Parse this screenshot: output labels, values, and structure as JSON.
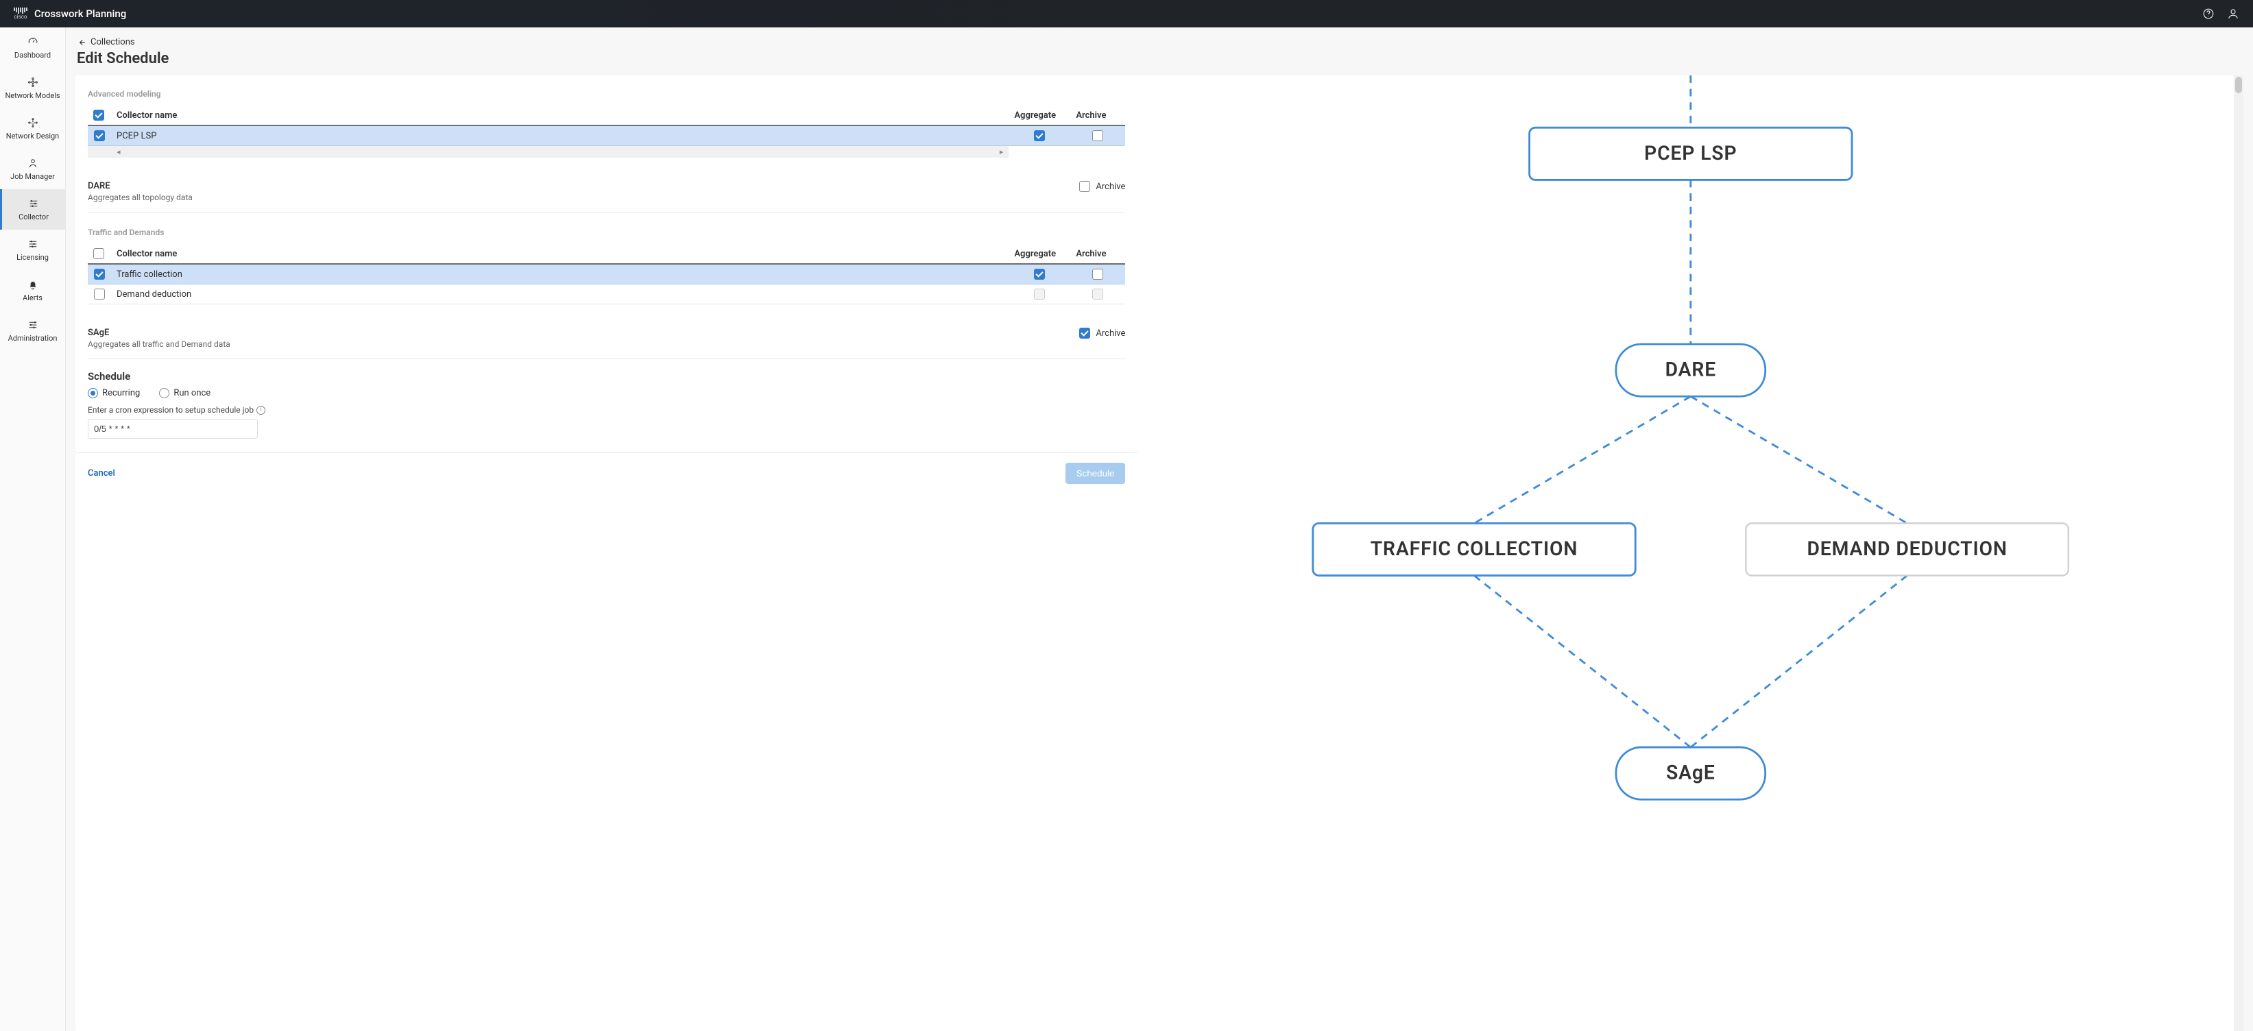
{
  "header": {
    "brand_sub": "cisco",
    "title": "Crosswork Planning"
  },
  "nav": {
    "items": [
      {
        "id": "dashboard",
        "label": "Dashboard"
      },
      {
        "id": "network-models",
        "label": "Network Models"
      },
      {
        "id": "network-design",
        "label": "Network Design"
      },
      {
        "id": "job-manager",
        "label": "Job Manager"
      },
      {
        "id": "collector",
        "label": "Collector"
      },
      {
        "id": "licensing",
        "label": "Licensing"
      },
      {
        "id": "alerts",
        "label": "Alerts"
      },
      {
        "id": "administration",
        "label": "Administration"
      }
    ],
    "active": "collector"
  },
  "breadcrumb": {
    "label": "Collections"
  },
  "page": {
    "title": "Edit Schedule"
  },
  "sections": {
    "advanced": {
      "title": "Advanced modeling",
      "cols": {
        "name": "Collector name",
        "aggregate": "Aggregate",
        "archive": "Archive"
      },
      "head_checked": true,
      "rows": [
        {
          "name": "PCEP LSP",
          "checked": true,
          "aggregate": true,
          "archive": false,
          "highlight": true
        }
      ]
    },
    "dare": {
      "title": "DARE",
      "desc": "Aggregates all topology data",
      "archive_label": "Archive",
      "archive_checked": false
    },
    "traffic": {
      "title": "Traffic and Demands",
      "cols": {
        "name": "Collector name",
        "aggregate": "Aggregate",
        "archive": "Archive"
      },
      "head_checked": false,
      "rows": [
        {
          "name": "Traffic collection",
          "checked": true,
          "aggregate": true,
          "archive": false,
          "highlight": true
        },
        {
          "name": "Demand deduction",
          "checked": false,
          "aggregate_disabled": true,
          "archive_disabled": true,
          "highlight": false
        }
      ]
    },
    "sage": {
      "title": "SAgE",
      "desc": "Aggregates all traffic and Demand data",
      "archive_label": "Archive",
      "archive_checked": true
    }
  },
  "schedule": {
    "title": "Schedule",
    "opt_recurring": "Recurring",
    "opt_runonce": "Run once",
    "selected": "recurring",
    "hint": "Enter a cron expression to setup schedule job",
    "cron_value": "0/5 * * * *"
  },
  "footer": {
    "cancel": "Cancel",
    "schedule": "Schedule"
  },
  "diagram": {
    "nodes": {
      "pcep": "PCEP LSP",
      "dare": "DARE",
      "traffic": "TRAFFIC COLLECTION",
      "demand": "DEMAND DEDUCTION",
      "sage": "SAgE"
    }
  }
}
